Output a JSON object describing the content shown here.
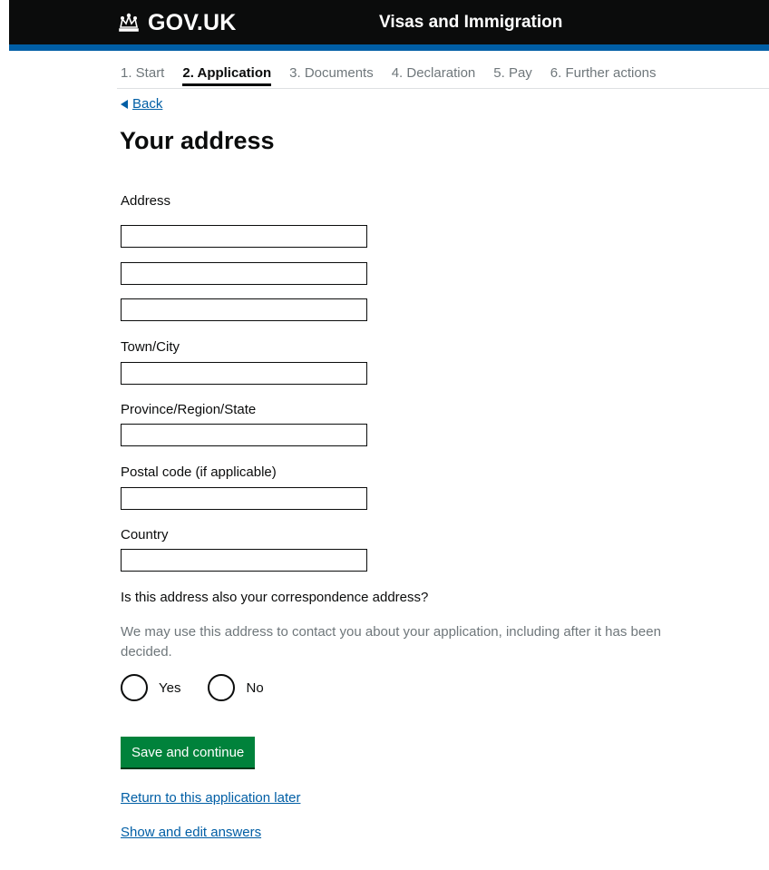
{
  "header": {
    "logo_text": "GOV.UK",
    "service_name": "Visas and Immigration",
    "colors": {
      "bar": "#0b0c0c",
      "accent": "#005ea5"
    }
  },
  "progress": {
    "steps": [
      {
        "label": "1. Start",
        "active": false
      },
      {
        "label": "2. Application",
        "active": true
      },
      {
        "label": "3. Documents",
        "active": false
      },
      {
        "label": "4. Declaration",
        "active": false
      },
      {
        "label": "5. Pay",
        "active": false
      },
      {
        "label": "6. Further actions",
        "active": false
      }
    ]
  },
  "back_link": "Back",
  "page_title": "Your address",
  "form": {
    "address_label": "Address",
    "address_line_1": "",
    "address_line_2": "",
    "address_line_3": "",
    "town_label": "Town/City",
    "town_value": "",
    "province_label": "Province/Region/State",
    "province_value": "",
    "postal_label": "Postal code (if applicable)",
    "postal_value": "",
    "country_label": "Country",
    "country_value": "",
    "correspondence_question": "Is this address also your correspondence address?",
    "correspondence_hint": "We may use this address to contact you about your application, including after it has been decided.",
    "radio_yes": "Yes",
    "radio_no": "No",
    "selected": null
  },
  "actions": {
    "save_label": "Save and continue",
    "save_color": "#00823b",
    "return_link": "Return to this application later",
    "show_edit_link": "Show and edit answers"
  }
}
